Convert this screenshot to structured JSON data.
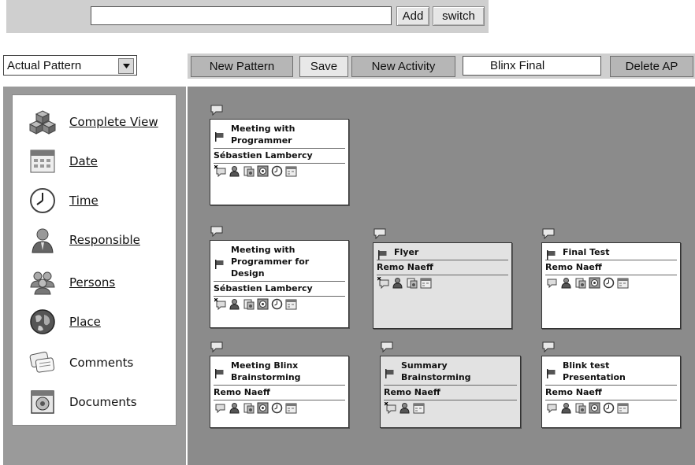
{
  "top": {
    "input_value": "",
    "add_label": "Add",
    "switch_label": "switch"
  },
  "pattern_select": {
    "selected": "Actual Pattern"
  },
  "toolbar": {
    "new_pattern": "New Pattern",
    "save": "Save",
    "new_activity": "New Activity",
    "pattern_name": "Blinx Final",
    "delete": "Delete AP"
  },
  "sidebar": {
    "items": [
      {
        "label": "Complete View",
        "icon": "cubes-icon",
        "link": true
      },
      {
        "label": "Date",
        "icon": "calendar-icon",
        "link": true
      },
      {
        "label": "Time",
        "icon": "clock-icon",
        "link": true
      },
      {
        "label": "Responsible",
        "icon": "person-icon",
        "link": true
      },
      {
        "label": "Persons",
        "icon": "group-icon",
        "link": true
      },
      {
        "label": "Place",
        "icon": "globe-icon",
        "link": true
      },
      {
        "label": "Comments",
        "icon": "comments-icon",
        "link": false
      },
      {
        "label": "Documents",
        "icon": "documents-icon",
        "link": false
      }
    ]
  },
  "activities": [
    {
      "title1": "Meeting with",
      "title2": "Programmer",
      "title3": "",
      "person": "Sébastien Lambercy",
      "icons": [
        "comment-x-icon",
        "person-icon",
        "document-icon",
        "place-icon",
        "clock-icon",
        "calendar-icon"
      ]
    },
    {
      "title1": "Meeting with",
      "title2": "Programmer for",
      "title3": "Design",
      "person": "Sébastien Lambercy",
      "icons": [
        "comment-x-icon",
        "person-icon",
        "document-icon",
        "place-icon",
        "clock-icon",
        "calendar-icon"
      ]
    },
    {
      "title1": "Flyer",
      "title2": "",
      "title3": "",
      "person": "Remo Naeff",
      "icons": [
        "comment-x-icon",
        "person-icon",
        "document-icon",
        "calendar-icon"
      ]
    },
    {
      "title1": "Final Test",
      "title2": "",
      "title3": "",
      "person": "Remo Naeff",
      "icons": [
        "comment-icon",
        "person-icon",
        "document-icon",
        "place-icon",
        "clock-icon",
        "calendar-icon"
      ]
    },
    {
      "title1": "Meeting Blinx",
      "title2": "Brainstorming",
      "title3": "",
      "person": "Remo Naeff",
      "icons": [
        "comment-icon",
        "person-icon",
        "document-icon",
        "place-icon",
        "clock-icon",
        "calendar-icon"
      ]
    },
    {
      "title1": "Summary",
      "title2": "Brainstorming",
      "title3": "",
      "person": "Remo Naeff",
      "icons": [
        "comment-x-icon",
        "person-icon",
        "calendar-icon"
      ]
    },
    {
      "title1": "Blink test",
      "title2": "Presentation",
      "title3": "",
      "person": "Remo Naeff",
      "icons": [
        "comment-icon",
        "person-icon",
        "document-icon",
        "place-icon",
        "clock-icon",
        "calendar-icon"
      ]
    }
  ]
}
